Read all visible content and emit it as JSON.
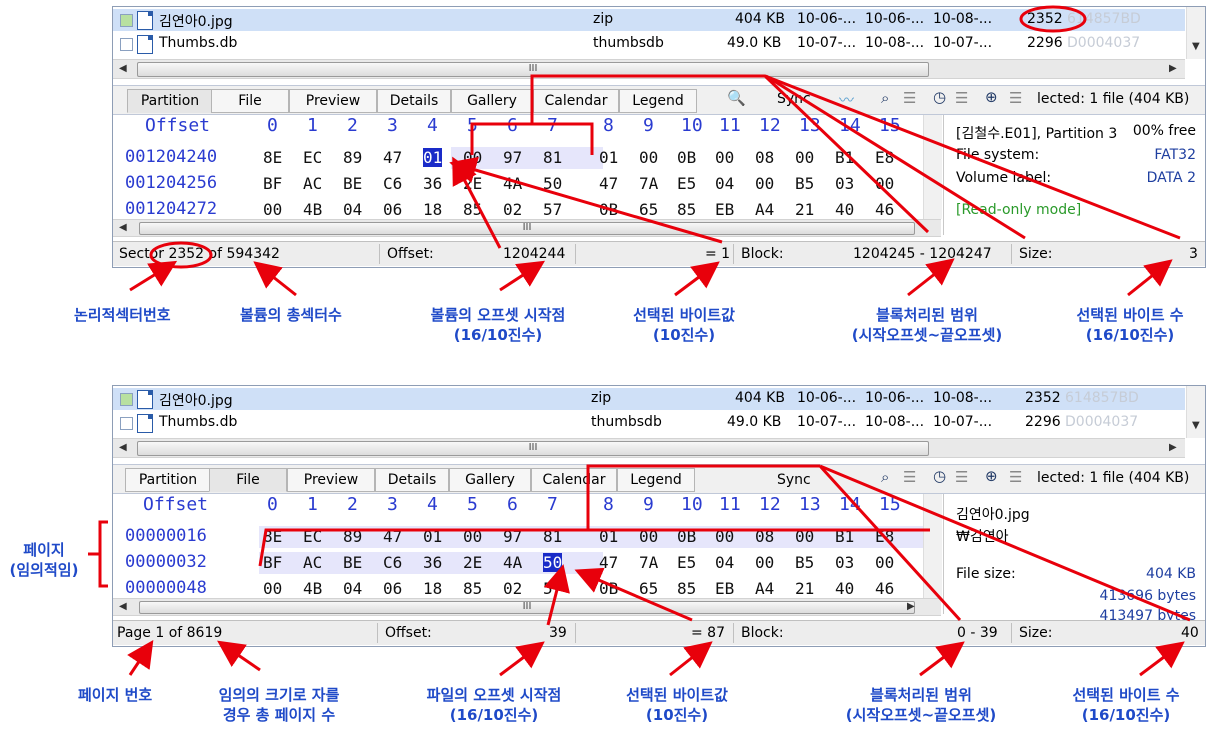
{
  "panel1": {
    "files": [
      {
        "name": "김연아0.jpg",
        "type": "zip",
        "size": "404 KB",
        "d1": "10-06-...",
        "d2": "10-06-...",
        "d3": "10-08-...",
        "sector": "2352",
        "hash": "614857BD"
      },
      {
        "name": "Thumbs.db",
        "type": "thumbsdb",
        "size": "49.0 KB",
        "d1": "10-07-...",
        "d2": "10-08-...",
        "d3": "10-07-...",
        "sector": "2296",
        "hash": "D0004037"
      }
    ],
    "tabs": [
      "Partition",
      "File",
      "Preview",
      "Details",
      "Gallery",
      "Calendar",
      "Legend"
    ],
    "sync_label": "Sync",
    "selected_text": "lected: 1 file (404 KB)",
    "hex_header_label": "Offset",
    "hex_columns": [
      "0",
      "1",
      "2",
      "3",
      "4",
      "5",
      "6",
      "7",
      "8",
      "9",
      "10",
      "11",
      "12",
      "13",
      "14",
      "15"
    ],
    "rows": [
      {
        "offset": "001204240",
        "bytes": [
          "8E",
          "EC",
          "89",
          "47",
          "01",
          "00",
          "97",
          "81",
          "01",
          "00",
          "0B",
          "00",
          "08",
          "00",
          "B1",
          "E8"
        ]
      },
      {
        "offset": "001204256",
        "bytes": [
          "BF",
          "AC",
          "BE",
          "C6",
          "36",
          "2E",
          "4A",
          "50",
          "47",
          "7A",
          "E5",
          "04",
          "00",
          "B5",
          "03",
          "00"
        ]
      },
      {
        "offset": "001204272",
        "bytes": [
          "00",
          "4B",
          "04",
          "06",
          "18",
          "85",
          "02",
          "57",
          "0B",
          "65",
          "85",
          "EB",
          "A4",
          "21",
          "40",
          "46"
        ]
      }
    ],
    "info": {
      "line1": "[김철수.E01], Partition 3",
      "line1_right": "00% free",
      "fs_label": "File system:",
      "fs_value": "FAT32",
      "vol_label": "Volume label:",
      "vol_value": "DATA 2",
      "mode": "[Read-only mode]"
    },
    "status": {
      "sector": "Sector 2352 of 594342",
      "offset_label": "Offset:",
      "offset_value": "1204244",
      "value": "= 1",
      "block_label": "Block:",
      "block_value": "1204245 - 1204247",
      "size_label": "Size:",
      "size_value": "3"
    }
  },
  "panel2": {
    "files": [
      {
        "name": "김연아0.jpg",
        "type": "zip",
        "size": "404 KB",
        "d1": "10-06-...",
        "d2": "10-06-...",
        "d3": "10-08-...",
        "sector": "2352",
        "hash": "614857BD"
      },
      {
        "name": "Thumbs.db",
        "type": "thumbsdb",
        "size": "49.0 KB",
        "d1": "10-07-...",
        "d2": "10-08-...",
        "d3": "10-07-...",
        "sector": "2296",
        "hash": "D0004037"
      }
    ],
    "tabs": [
      "Partition",
      "File",
      "Preview",
      "Details",
      "Gallery",
      "Calendar",
      "Legend"
    ],
    "sync_label": "Sync",
    "selected_text": "lected: 1 file (404 KB)",
    "hex_header_label": "Offset",
    "hex_columns": [
      "0",
      "1",
      "2",
      "3",
      "4",
      "5",
      "6",
      "7",
      "8",
      "9",
      "10",
      "11",
      "12",
      "13",
      "14",
      "15"
    ],
    "rows": [
      {
        "offset": "00000016",
        "bytes": [
          "8E",
          "EC",
          "89",
          "47",
          "01",
          "00",
          "97",
          "81",
          "01",
          "00",
          "0B",
          "00",
          "08",
          "00",
          "B1",
          "E8"
        ]
      },
      {
        "offset": "00000032",
        "bytes": [
          "BF",
          "AC",
          "BE",
          "C6",
          "36",
          "2E",
          "4A",
          "50",
          "47",
          "7A",
          "E5",
          "04",
          "00",
          "B5",
          "03",
          "00"
        ]
      },
      {
        "offset": "00000048",
        "bytes": [
          "00",
          "4B",
          "04",
          "06",
          "18",
          "85",
          "02",
          "57",
          "0B",
          "65",
          "85",
          "EB",
          "A4",
          "21",
          "40",
          "46"
        ]
      }
    ],
    "info": {
      "name": "김연아0.jpg",
      "path": "₩김연아",
      "size_label": "File size:",
      "size_kb": "404 KB",
      "size_bytes": "413696 bytes",
      "partial": "413497 bytes"
    },
    "status": {
      "page": "Page 1 of 8619",
      "offset_label": "Offset:",
      "offset_value": "39",
      "value": "= 87",
      "block_label": "Block:",
      "block_value": "0 - 39",
      "size_label": "Size:",
      "size_value": "40"
    }
  },
  "callouts1": {
    "logical_sector": "논리적섹터번호",
    "total_sectors": "볼륨의 총섹터수",
    "offset_start": "볼륨의 오프셋 시작점",
    "offset_start_sub": "(16/10진수)",
    "byte_value": "선택된 바이트값",
    "byte_value_sub": "(10진수)",
    "block_range": "블록처리된 범위",
    "block_range_sub": "(시작오프셋~끝오프셋)",
    "byte_count": "선택된 바이트 수",
    "byte_count_sub": "(16/10진수)"
  },
  "callouts2": {
    "page_arbitrary": "페이지",
    "page_arbitrary_sub": "(임의적임)",
    "page_number": "페이지 번호",
    "total_pages": "임의의 크기로 자를",
    "total_pages_sub": "경우 총 페이지 수",
    "offset_start": "파일의 오프셋 시작점",
    "offset_start_sub": "(16/10진수)",
    "byte_value": "선택된 바이트값",
    "byte_value_sub": "(10진수)",
    "block_range": "블록처리된 범위",
    "block_range_sub": "(시작오프셋~끝오프셋)",
    "byte_count": "선택된 바이트 수",
    "byte_count_sub": "(16/10진수)"
  },
  "colors": {
    "annotation": "#e8000b",
    "callout_text": "#1f4ac8",
    "hex_blue": "#2a3bd0",
    "selection": "#cfe0f7"
  }
}
